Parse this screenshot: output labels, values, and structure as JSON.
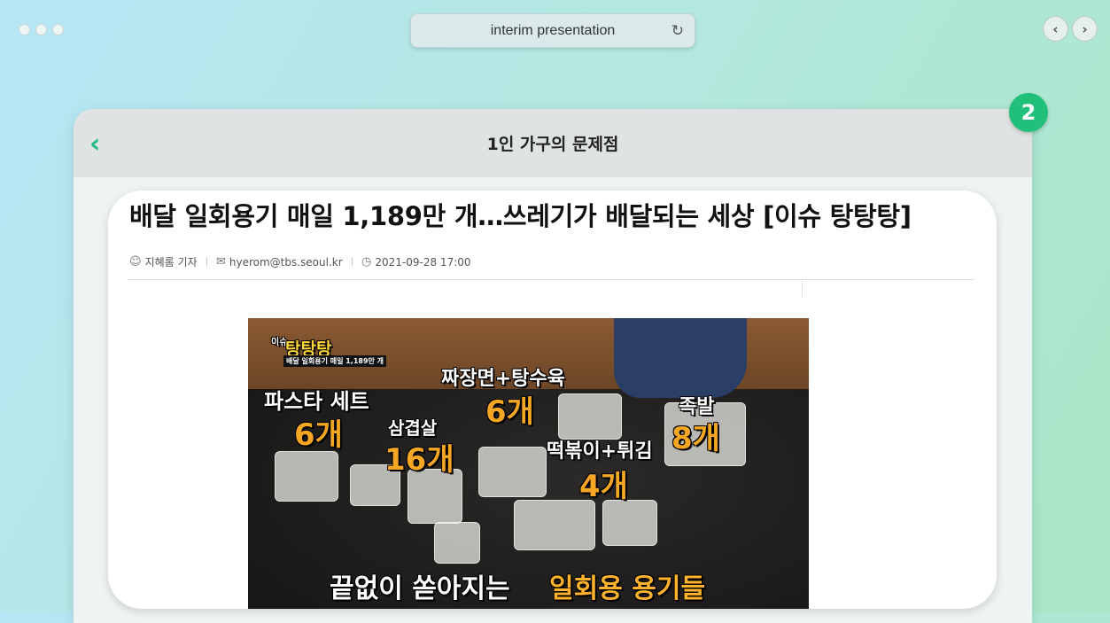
{
  "window": {
    "address_title": "interim presentation",
    "reload_icon": "reload-icon",
    "back_icon": "chevron-left-icon",
    "forward_icon": "chevron-right-icon"
  },
  "slide": {
    "title": "1인 가구의 문제점",
    "page_badge": "2",
    "accent_color": "#20c07a"
  },
  "article": {
    "headline": "배달 일회용기 매일 1,189만 개…쓰레기가 배달되는 세상 [이슈 탕탕탕]",
    "author": "지혜롬 기자",
    "email": "hyerom@tbs.seoul.kr",
    "datetime": "2021-09-28 17:00"
  },
  "photo": {
    "logo_small": "이슈",
    "logo": "탕탕탕",
    "logo_sub": "배달 일회용기 매일 1,189만 개",
    "label_pasta": "파스타 세트",
    "count_pasta": "6개",
    "label_jjajang": "짜장면+탕수육",
    "count_jjajang": "6개",
    "label_samgyeop": "삼겹살",
    "count_samgyeop": "16개",
    "label_tteok": "떡볶이+튀김",
    "count_tteok": "4개",
    "label_jokbal": "족발",
    "count_jokbal": "8개",
    "caption_white": "끝없이 쏟아지는",
    "caption_orange": "일회용 용기들"
  }
}
